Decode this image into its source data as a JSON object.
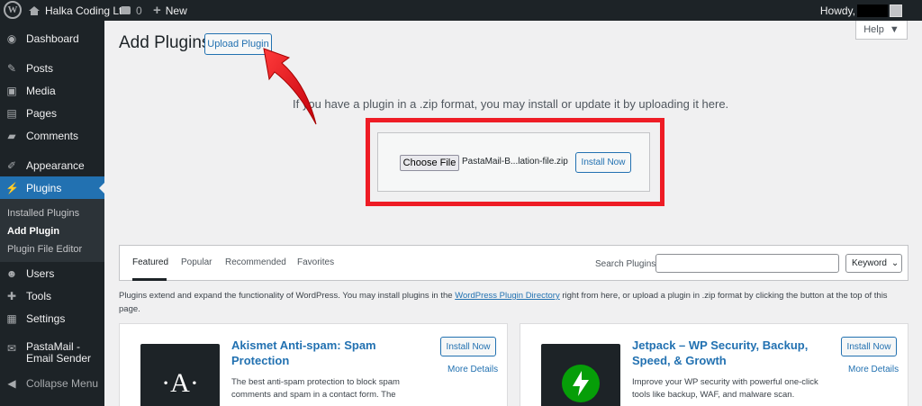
{
  "adminbar": {
    "site_name": "Halka Coding Ltd.",
    "comments_count": "0",
    "new_label": "New",
    "howdy": "Howdy,"
  },
  "sidebar": {
    "items": [
      {
        "label": "Dashboard",
        "icon": "dashboard-icon"
      },
      {
        "label": "Posts",
        "icon": "pin-icon"
      },
      {
        "label": "Media",
        "icon": "media-icon"
      },
      {
        "label": "Pages",
        "icon": "page-icon"
      },
      {
        "label": "Comments",
        "icon": "comment-icon"
      },
      {
        "label": "Appearance",
        "icon": "brush-icon"
      },
      {
        "label": "Plugins",
        "icon": "plug-icon"
      },
      {
        "label": "Users",
        "icon": "user-icon"
      },
      {
        "label": "Tools",
        "icon": "wrench-icon"
      },
      {
        "label": "Settings",
        "icon": "settings-icon"
      },
      {
        "label": "PastaMail - Email Sender",
        "icon": "email-icon"
      },
      {
        "label": "Collapse Menu",
        "icon": "collapse-icon"
      }
    ],
    "submenu": [
      "Installed Plugins",
      "Add Plugin",
      "Plugin File Editor"
    ]
  },
  "main": {
    "title": "Add Plugins",
    "upload_button": "Upload Plugin",
    "help": "Help",
    "upload_text": "If you have a plugin in a .zip format, you may install or update it by uploading it here.",
    "choose_file": "Choose File",
    "file_name": "PastaMail-B...lation-file.zip",
    "install_now": "Install Now"
  },
  "filter": {
    "tabs": [
      "Featured",
      "Popular",
      "Recommended",
      "Favorites"
    ],
    "search_label": "Search Plugins",
    "search_value": "",
    "select_value": "Keyword"
  },
  "intro": {
    "before": "Plugins extend and expand the functionality of WordPress. You may install plugins in the ",
    "link": "WordPress Plugin Directory",
    "after": " right from here, or upload a plugin in .zip format by clicking the button at the top of this page."
  },
  "cards": [
    {
      "name": "Akismet Anti-spam: Spam Protection",
      "install": "Install Now",
      "more": "More Details",
      "desc": "The best anti-spam protection to block spam comments and spam in a contact form. The",
      "thumb": "·A·"
    },
    {
      "name": "Jetpack – WP Security, Backup, Speed, & Growth",
      "install": "Install Now",
      "more": "More Details",
      "desc": "Improve your WP security with powerful one-click tools like backup, WAF, and malware scan."
    }
  ],
  "colors": {
    "accent": "#2271b1",
    "sidebar_bg": "#1d2327",
    "highlight": "#ee1c25",
    "jetpack_green": "#069e08"
  }
}
